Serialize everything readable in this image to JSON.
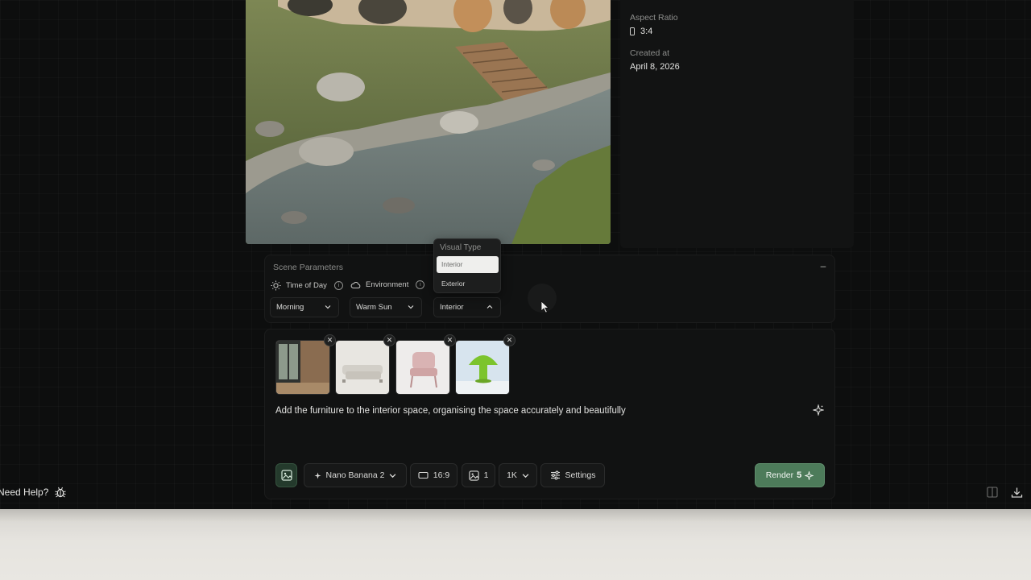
{
  "details": {
    "aspect_ratio_label": "Aspect Ratio",
    "aspect_ratio_value": "3:4",
    "created_label": "Created at",
    "created_value": "April 8, 2026"
  },
  "scene": {
    "title": "Scene Parameters",
    "collapse_symbol": "–",
    "time_of_day": {
      "label": "Time of Day",
      "value": "Morning"
    },
    "environment": {
      "label": "Environment",
      "value": "Warm Sun"
    },
    "visual_type": {
      "label": "Visual Type",
      "value": "Interior",
      "options": [
        "Interior",
        "Exterior"
      ]
    }
  },
  "prompt": {
    "attachments": [
      "interior-room-photo",
      "white-sofa-photo",
      "pink-armchair-photo",
      "green-mushroom-lamp-photo"
    ],
    "remove_symbol": "✕",
    "text": "Add the furniture to the interior space, organising the space accurately and beautifully"
  },
  "toolbar": {
    "model": "Nano Banana 2",
    "aspect": "16:9",
    "count": "1",
    "resolution": "1K",
    "settings": "Settings",
    "render_label": "Render",
    "render_cost": "5"
  },
  "footer": {
    "help": "Need Help?"
  },
  "colors": {
    "accent_green": "#4d7b5a",
    "background": "#0d0e0e",
    "panel": "#111212"
  },
  "icons": [
    "sun-icon",
    "cloud-icon",
    "info-icon",
    "chevron-down-icon",
    "chevron-up-icon",
    "image-icon",
    "sparkle-icon",
    "rectangle-icon",
    "sliders-icon",
    "bug-icon",
    "split-view-icon",
    "download-icon",
    "phone-icon"
  ]
}
